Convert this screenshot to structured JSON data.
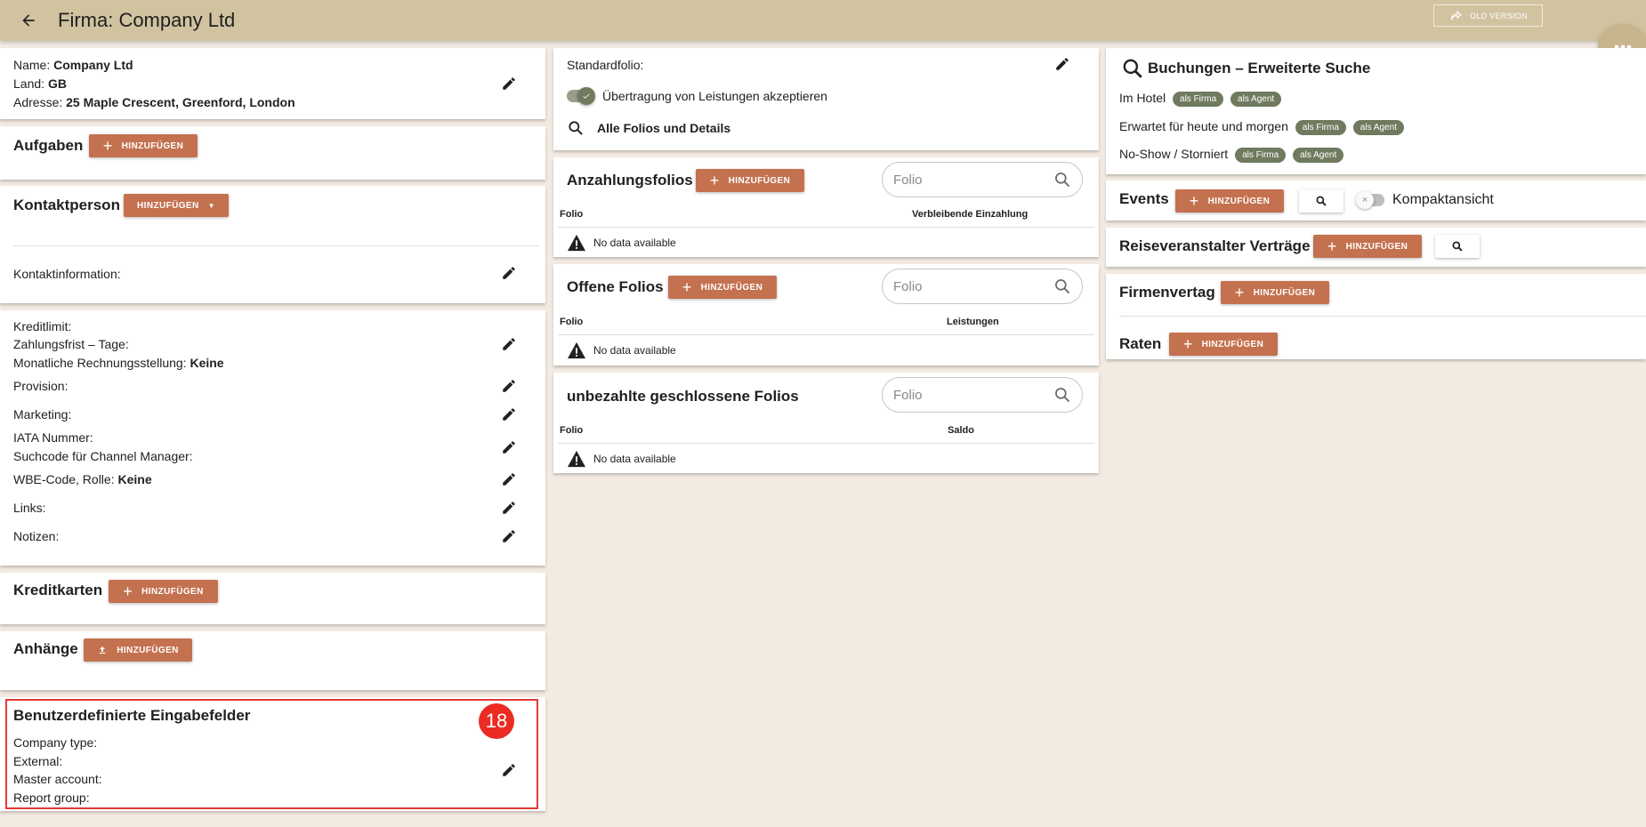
{
  "header": {
    "title": "Firma: Company Ltd",
    "old_version_label": "OLD VERSION"
  },
  "company_info": {
    "name_label": "Name:",
    "name_value": "Company Ltd",
    "country_label": "Land:",
    "country_value": "GB",
    "address_label": "Adresse:",
    "address_value": "25 Maple Crescent, Greenford, London"
  },
  "tasks": {
    "title": "Aufgaben",
    "add_label": "HINZUFÜGEN"
  },
  "contact": {
    "title": "Kontaktperson",
    "add_label": "HINZUFÜGEN",
    "info_label": "Kontaktinformation:"
  },
  "finance": {
    "credit_limit_label": "Kreditlimit:",
    "payment_days_label": "Zahlungsfrist – Tage:",
    "monthly_billing_label": "Monatliche Rechnungsstellung:",
    "monthly_billing_value": "Keine",
    "commission_label": "Provision:",
    "marketing_label": "Marketing:",
    "iata_label": "IATA Nummer:",
    "channel_code_label": "Suchcode für Channel Manager:",
    "wbe_label": "WBE-Code, Rolle:",
    "wbe_value": "Keine",
    "links_label": "Links:",
    "notes_label": "Notizen:"
  },
  "credit_cards": {
    "title": "Kreditkarten",
    "add_label": "HINZUFÜGEN"
  },
  "attachments": {
    "title": "Anhänge",
    "add_label": "HINZUFÜGEN"
  },
  "custom_fields": {
    "title": "Benutzerdefinierte Eingabefelder",
    "badge": "18",
    "fields": [
      "Company type:",
      "External:",
      "Master account:",
      "Report group:"
    ]
  },
  "folio_settings": {
    "default_folio_label": "Standardfolio:",
    "transfer_toggle_label": "Übertragung von Leistungen akzeptieren",
    "transfer_toggle_on": true,
    "all_folios_label": "Alle Folios und Details"
  },
  "deposit_folios": {
    "title": "Anzahlungsfolios",
    "add_label": "HINZUFÜGEN",
    "search_placeholder": "Folio",
    "col_folio": "Folio",
    "col_other": "Verbleibende Einzahlung",
    "no_data": "No data available"
  },
  "open_folios": {
    "title": "Offene Folios",
    "add_label": "HINZUFÜGEN",
    "search_placeholder": "Folio",
    "col_folio": "Folio",
    "col_other": "Leistungen",
    "no_data": "No data available"
  },
  "unpaid_folios": {
    "title": "unbezahlte geschlossene Folios",
    "search_placeholder": "Folio",
    "col_folio": "Folio",
    "col_other": "Saldo",
    "no_data": "No data available"
  },
  "bookings": {
    "title": "Buchungen – Erweiterte Suche",
    "rows": [
      {
        "label": "Im Hotel",
        "chip1": "als Firma",
        "chip2": "als Agent"
      },
      {
        "label": "Erwartet für heute und morgen",
        "chip1": "als Firma",
        "chip2": "als Agent"
      },
      {
        "label": "No-Show / Storniert",
        "chip1": "als Firma",
        "chip2": "als Agent"
      }
    ]
  },
  "events": {
    "title": "Events",
    "add_label": "HINZUFÜGEN",
    "compact_label": "Kompaktansicht",
    "compact_on": false
  },
  "tour_contracts": {
    "title": "Reiseveranstalter Verträge",
    "add_label": "HINZUFÜGEN"
  },
  "company_contract": {
    "title": "Firmenvertag",
    "add_label": "HINZUFÜGEN"
  },
  "rates": {
    "title": "Raten",
    "add_label": "HINZUFÜGEN"
  },
  "colors": {
    "header_bg": "#d1c2a0",
    "page_bg": "#f3ebe2",
    "accent_button": "#c4714f",
    "chip": "#6f7a5f",
    "badge": "#ec2b23",
    "highlight_border": "#e53935"
  }
}
